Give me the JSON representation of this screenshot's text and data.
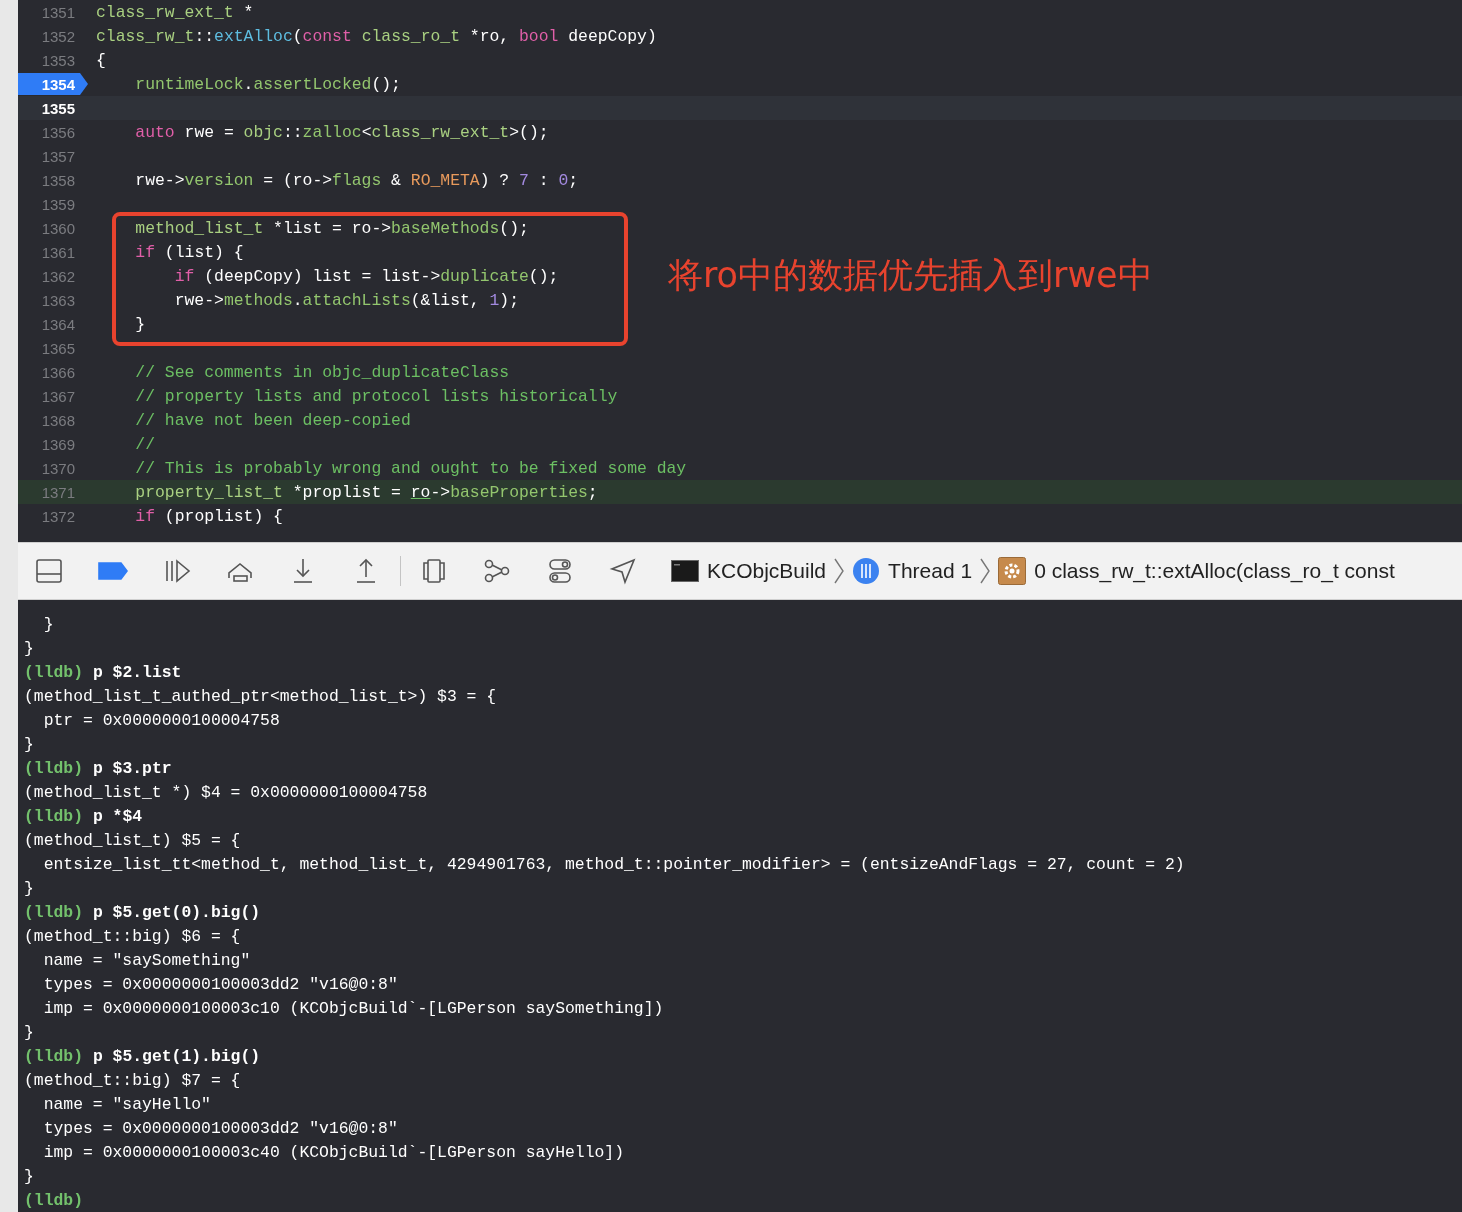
{
  "editor": {
    "lines": [
      {
        "number": "1351",
        "breakpoint": false,
        "cursor_line": false,
        "pc_line": false,
        "tokens": [
          {
            "text": "class_rw_ext_t",
            "kind": "type"
          },
          {
            "text": " *",
            "kind": "plain"
          }
        ]
      },
      {
        "number": "1352",
        "breakpoint": false,
        "cursor_line": false,
        "pc_line": false,
        "tokens": [
          {
            "text": "class_rw_t",
            "kind": "type"
          },
          {
            "text": "::",
            "kind": "plain"
          },
          {
            "text": "extAlloc",
            "kind": "func"
          },
          {
            "text": "(",
            "kind": "plain"
          },
          {
            "text": "const",
            "kind": "keyword"
          },
          {
            "text": " class_ro_t",
            "kind": "type"
          },
          {
            "text": " *ro, ",
            "kind": "plain"
          },
          {
            "text": "bool",
            "kind": "keyword"
          },
          {
            "text": " deepCopy)",
            "kind": "plain"
          }
        ]
      },
      {
        "number": "1353",
        "breakpoint": false,
        "cursor_line": false,
        "pc_line": false,
        "tokens": [
          {
            "text": "{",
            "kind": "plain"
          }
        ]
      },
      {
        "number": "1354",
        "breakpoint": true,
        "cursor_line": false,
        "pc_line": false,
        "tokens": [
          {
            "text": "    runtimeLock",
            "kind": "member"
          },
          {
            "text": ".",
            "kind": "plain"
          },
          {
            "text": "assertLocked",
            "kind": "member"
          },
          {
            "text": "();",
            "kind": "plain"
          }
        ]
      },
      {
        "number": "1355",
        "breakpoint": false,
        "cursor_line": true,
        "pc_line": false
      },
      {
        "number": "1356",
        "breakpoint": false,
        "cursor_line": false,
        "pc_line": false,
        "tokens": [
          {
            "text": "    auto",
            "kind": "keyword"
          },
          {
            "text": " rwe = ",
            "kind": "plain"
          },
          {
            "text": "objc",
            "kind": "type"
          },
          {
            "text": "::",
            "kind": "plain"
          },
          {
            "text": "zalloc",
            "kind": "member"
          },
          {
            "text": "<",
            "kind": "plain"
          },
          {
            "text": "class_rw_ext_t",
            "kind": "type"
          },
          {
            "text": ">();",
            "kind": "plain"
          }
        ]
      },
      {
        "number": "1357",
        "breakpoint": false,
        "cursor_line": false,
        "pc_line": false
      },
      {
        "number": "1358",
        "breakpoint": false,
        "cursor_line": false,
        "pc_line": false,
        "tokens": [
          {
            "text": "    rwe->",
            "kind": "plain"
          },
          {
            "text": "version",
            "kind": "member"
          },
          {
            "text": " = (ro->",
            "kind": "plain"
          },
          {
            "text": "flags",
            "kind": "member"
          },
          {
            "text": " & ",
            "kind": "plain"
          },
          {
            "text": "RO_META",
            "kind": "macro"
          },
          {
            "text": ") ? ",
            "kind": "plain"
          },
          {
            "text": "7",
            "kind": "number"
          },
          {
            "text": " : ",
            "kind": "plain"
          },
          {
            "text": "0",
            "kind": "number"
          },
          {
            "text": ";",
            "kind": "plain"
          }
        ]
      },
      {
        "number": "1359",
        "breakpoint": false,
        "cursor_line": false,
        "pc_line": false
      },
      {
        "number": "1360",
        "breakpoint": false,
        "cursor_line": false,
        "pc_line": false,
        "tokens": [
          {
            "text": "    method_list_t",
            "kind": "type"
          },
          {
            "text": " *list = ro->",
            "kind": "plain"
          },
          {
            "text": "baseMethods",
            "kind": "member"
          },
          {
            "text": "();",
            "kind": "plain"
          }
        ]
      },
      {
        "number": "1361",
        "breakpoint": false,
        "cursor_line": false,
        "pc_line": false,
        "tokens": [
          {
            "text": "    if",
            "kind": "keyword"
          },
          {
            "text": " (list) {",
            "kind": "plain"
          }
        ]
      },
      {
        "number": "1362",
        "breakpoint": false,
        "cursor_line": false,
        "pc_line": false,
        "tokens": [
          {
            "text": "        if",
            "kind": "keyword"
          },
          {
            "text": " (deepCopy) list = list->",
            "kind": "plain"
          },
          {
            "text": "duplicate",
            "kind": "member"
          },
          {
            "text": "();",
            "kind": "plain"
          }
        ]
      },
      {
        "number": "1363",
        "breakpoint": false,
        "cursor_line": false,
        "pc_line": false,
        "tokens": [
          {
            "text": "        rwe->",
            "kind": "plain"
          },
          {
            "text": "methods",
            "kind": "member"
          },
          {
            "text": ".",
            "kind": "plain"
          },
          {
            "text": "attachLists",
            "kind": "member"
          },
          {
            "text": "(&list, ",
            "kind": "plain"
          },
          {
            "text": "1",
            "kind": "number"
          },
          {
            "text": ");",
            "kind": "plain"
          }
        ]
      },
      {
        "number": "1364",
        "breakpoint": false,
        "cursor_line": false,
        "pc_line": false,
        "tokens": [
          {
            "text": "    }",
            "kind": "plain"
          }
        ]
      },
      {
        "number": "1365",
        "breakpoint": false,
        "cursor_line": false,
        "pc_line": false
      },
      {
        "number": "1366",
        "breakpoint": false,
        "cursor_line": false,
        "pc_line": false,
        "tokens": [
          {
            "text": "    // See comments in objc_duplicateClass",
            "kind": "comment"
          }
        ]
      },
      {
        "number": "1367",
        "breakpoint": false,
        "cursor_line": false,
        "pc_line": false,
        "tokens": [
          {
            "text": "    // property lists and protocol lists historically",
            "kind": "comment"
          }
        ]
      },
      {
        "number": "1368",
        "breakpoint": false,
        "cursor_line": false,
        "pc_line": false,
        "tokens": [
          {
            "text": "    // have not been deep-copied",
            "kind": "comment"
          }
        ]
      },
      {
        "number": "1369",
        "breakpoint": false,
        "cursor_line": false,
        "pc_line": false,
        "tokens": [
          {
            "text": "    //",
            "kind": "comment"
          }
        ]
      },
      {
        "number": "1370",
        "breakpoint": false,
        "cursor_line": false,
        "pc_line": false,
        "tokens": [
          {
            "text": "    // This is probably wrong and ought to be fixed some day",
            "kind": "comment"
          }
        ]
      },
      {
        "number": "1371",
        "breakpoint": false,
        "cursor_line": false,
        "pc_line": true,
        "tokens": [
          {
            "text": "    property_list_t",
            "kind": "type"
          },
          {
            "text": " *proplist = ",
            "kind": "plain"
          },
          {
            "text": "ro",
            "kind": "ref"
          },
          {
            "text": "->",
            "kind": "plain"
          },
          {
            "text": "baseProperties",
            "kind": "member"
          },
          {
            "text": ";",
            "kind": "plain"
          }
        ]
      },
      {
        "number": "1372",
        "breakpoint": false,
        "cursor_line": false,
        "pc_line": false,
        "tokens": [
          {
            "text": "    if",
            "kind": "keyword"
          },
          {
            "text": " (proplist) {",
            "kind": "plain"
          }
        ]
      }
    ],
    "annotation": {
      "text": "将ro中的数据优先插入到rwe中"
    }
  },
  "toolbar": {
    "buttons": [
      {
        "kind": "hide-panel"
      },
      {
        "kind": "breakpoints",
        "active": true
      },
      {
        "kind": "continue"
      },
      {
        "kind": "step-over"
      },
      {
        "kind": "step-into"
      },
      {
        "kind": "step-out"
      },
      {
        "kind": "separator"
      },
      {
        "kind": "view-hierarchy"
      },
      {
        "kind": "memory-graph"
      },
      {
        "kind": "environment"
      },
      {
        "kind": "location"
      }
    ],
    "breadcrumbs": [
      {
        "kind": "app",
        "label": "KCObjcBuild"
      },
      {
        "kind": "thread",
        "label": "Thread 1"
      },
      {
        "kind": "frame",
        "label": "0 class_rw_t::extAlloc(class_ro_t const"
      }
    ]
  },
  "console": {
    "lines": [
      {
        "kind": "output",
        "text": "  }"
      },
      {
        "kind": "output",
        "text": "}"
      },
      {
        "kind": "prompt",
        "prompt": "(lldb)",
        "command": "p $2.list"
      },
      {
        "kind": "output",
        "text": "(method_list_t_authed_ptr<method_list_t>) $3 = {"
      },
      {
        "kind": "output",
        "text": "  ptr = 0x0000000100004758"
      },
      {
        "kind": "output",
        "text": "}"
      },
      {
        "kind": "prompt",
        "prompt": "(lldb)",
        "command": "p $3.ptr"
      },
      {
        "kind": "output",
        "text": "(method_list_t *) $4 = 0x0000000100004758"
      },
      {
        "kind": "prompt",
        "prompt": "(lldb)",
        "command": "p *$4"
      },
      {
        "kind": "output",
        "text": "(method_list_t) $5 = {"
      },
      {
        "kind": "output",
        "text": "  entsize_list_tt<method_t, method_list_t, 4294901763, method_t::pointer_modifier> = (entsizeAndFlags = 27, count = 2)"
      },
      {
        "kind": "output",
        "text": "}"
      },
      {
        "kind": "prompt",
        "prompt": "(lldb)",
        "command": "p $5.get(0).big()"
      },
      {
        "kind": "output",
        "text": "(method_t::big) $6 = {"
      },
      {
        "kind": "output",
        "text": "  name = \"saySomething\""
      },
      {
        "kind": "output",
        "text": "  types = 0x0000000100003dd2 \"v16@0:8\""
      },
      {
        "kind": "output",
        "text": "  imp = 0x0000000100003c10 (KCObjcBuild`-[LGPerson saySomething])"
      },
      {
        "kind": "output",
        "text": "}"
      },
      {
        "kind": "prompt",
        "prompt": "(lldb)",
        "command": "p $5.get(1).big()"
      },
      {
        "kind": "output",
        "text": "(method_t::big) $7 = {"
      },
      {
        "kind": "output",
        "text": "  name = \"sayHello\""
      },
      {
        "kind": "output",
        "text": "  types = 0x0000000100003dd2 \"v16@0:8\""
      },
      {
        "kind": "output",
        "text": "  imp = 0x0000000100003c40 (KCObjcBuild`-[LGPerson sayHello])"
      },
      {
        "kind": "output",
        "text": "}"
      },
      {
        "kind": "prompt",
        "prompt": "(lldb)"
      }
    ]
  }
}
